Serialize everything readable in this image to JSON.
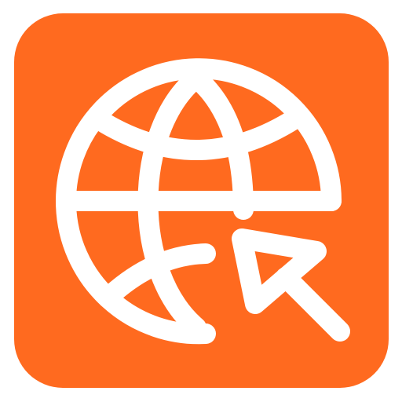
{
  "icon": {
    "name": "web-browse-icon",
    "glyphs": [
      "globe-icon",
      "cursor-arrow-icon"
    ]
  },
  "colors": {
    "background": "#ff6a1f",
    "foreground": "#ffffff",
    "page": "#ffffff"
  }
}
